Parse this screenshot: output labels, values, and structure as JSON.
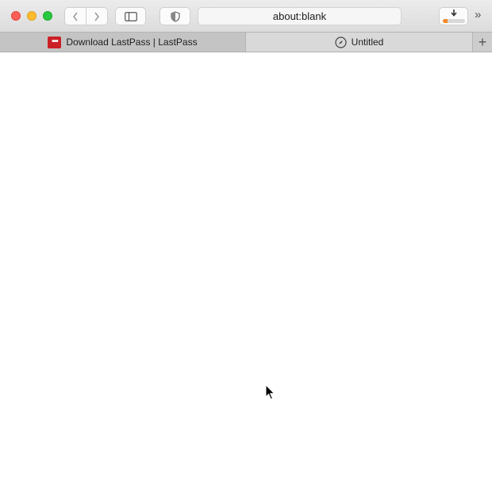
{
  "window": {
    "traffic_lights": [
      "close",
      "minimize",
      "zoom"
    ]
  },
  "toolbar": {
    "back_icon": "chevron-left-icon",
    "forward_icon": "chevron-right-icon",
    "sidebar_icon": "sidebar-icon",
    "privacy_icon": "shield-icon",
    "address": "about:blank",
    "download_progress": 0.2,
    "download_color": "#f18a2b",
    "overflow_label": "»"
  },
  "tabs": [
    {
      "label": "Download LastPass | LastPass",
      "favicon": "lastpass-logo",
      "favicon_text": "•••",
      "active": false
    },
    {
      "label": "Untitled",
      "favicon": "compass-icon",
      "active": true
    }
  ],
  "new_tab_label": "+"
}
